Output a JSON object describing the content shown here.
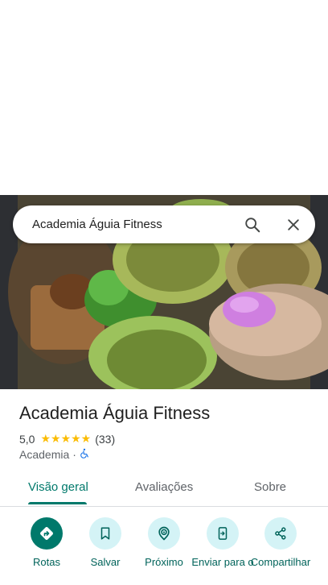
{
  "search": {
    "query": "Academia Águia Fitness"
  },
  "place": {
    "name": "Academia Águia Fitness",
    "rating": "5,0",
    "stars": "★★★★★",
    "review_count": "(33)",
    "category": "Academia",
    "separator": "·"
  },
  "tabs": [
    {
      "label": "Visão geral",
      "active": true
    },
    {
      "label": "Avaliações",
      "active": false
    },
    {
      "label": "Sobre",
      "active": false
    }
  ],
  "actions": [
    {
      "label": "Rotas",
      "icon": "directions-icon"
    },
    {
      "label": "Salvar",
      "icon": "bookmark-icon"
    },
    {
      "label": "Próximo",
      "icon": "nearby-icon"
    },
    {
      "label": "Enviar para o",
      "icon": "send-to-phone-icon"
    },
    {
      "label": "Compartilhar",
      "icon": "share-icon"
    }
  ],
  "colors": {
    "accent": "#00796b",
    "star": "#fbbc04",
    "chip_bg": "#d4f3f6"
  }
}
